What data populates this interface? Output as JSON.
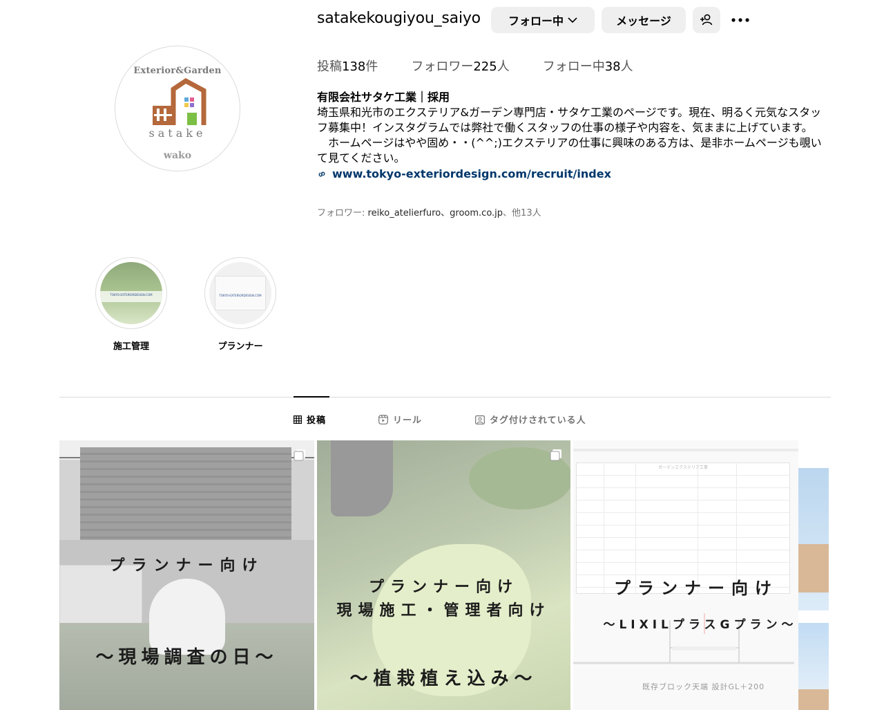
{
  "profile": {
    "username": "satakekougiyou_saiyo",
    "avatar": {
      "top_text": "Exterior&Garden",
      "word": "satake",
      "bottom_text": "wako"
    }
  },
  "actions": {
    "follow_label": "フォロー中",
    "message_label": "メッセージ",
    "add_user_icon": "person-add-icon",
    "more_icon": "more-horizontal-icon"
  },
  "stats": {
    "posts_label": "投稿",
    "posts_count": "138",
    "posts_unit": "件",
    "followers_label": "フォロワー",
    "followers_count": "225",
    "followers_unit": "人",
    "following_label": "フォロー中",
    "following_count": "38",
    "following_unit": "人"
  },
  "bio": {
    "name": "有限会社サタケ工業｜採用",
    "text": "埼玉県和光市のエクステリア&ガーデン専門店・サタケ工業のページです。現在、明るく元気なスタッフ募集中！インスタグラムでは弊社で働くスタッフの仕事の様子や内容を、気ままに上げています。\n　ホームページはやや固め・・(^^;)エクステリアの仕事に興味のある方は、是非ホームページも覗いて見てください。",
    "link": "www.tokyo-exteriordesign.com/recruit/index"
  },
  "followed_by": {
    "prefix": "フォロワー: ",
    "names": "reiko_atelierfuro、groom.co.jp",
    "suffix": "、他13人"
  },
  "highlights": [
    {
      "label": "施工管理",
      "thumb_text": "TOKYO-EXTERIORDESIGN.COM"
    },
    {
      "label": "プランナー",
      "thumb_text": "TOKYO-EXTERIORDESIGN.COM"
    }
  ],
  "tabs": [
    {
      "label": "投稿",
      "icon": "grid-icon",
      "active": true
    },
    {
      "label": "リール",
      "icon": "reels-icon",
      "active": false
    },
    {
      "label": "タグ付けされている人",
      "icon": "tagged-icon",
      "active": false
    }
  ],
  "posts": [
    {
      "line1": "プランナー向け",
      "line2": "～現場調査の日～"
    },
    {
      "line1": "プランナー向け",
      "line2": "現場施工・管理者向け",
      "line3": "～植栽植え込み～"
    },
    {
      "line1": "プランナー向け",
      "line2": "～LIXILプラスGプラン～",
      "plan_caption": "既存ブロック天端 設計GL＋200",
      "table_title": "ガーデンエクステリア工事"
    }
  ],
  "colors": {
    "link": "#00376b",
    "button_bg": "#efefef",
    "muted": "#737373",
    "logo_orange": "#b4683b",
    "logo_green": "#7cbf45"
  }
}
